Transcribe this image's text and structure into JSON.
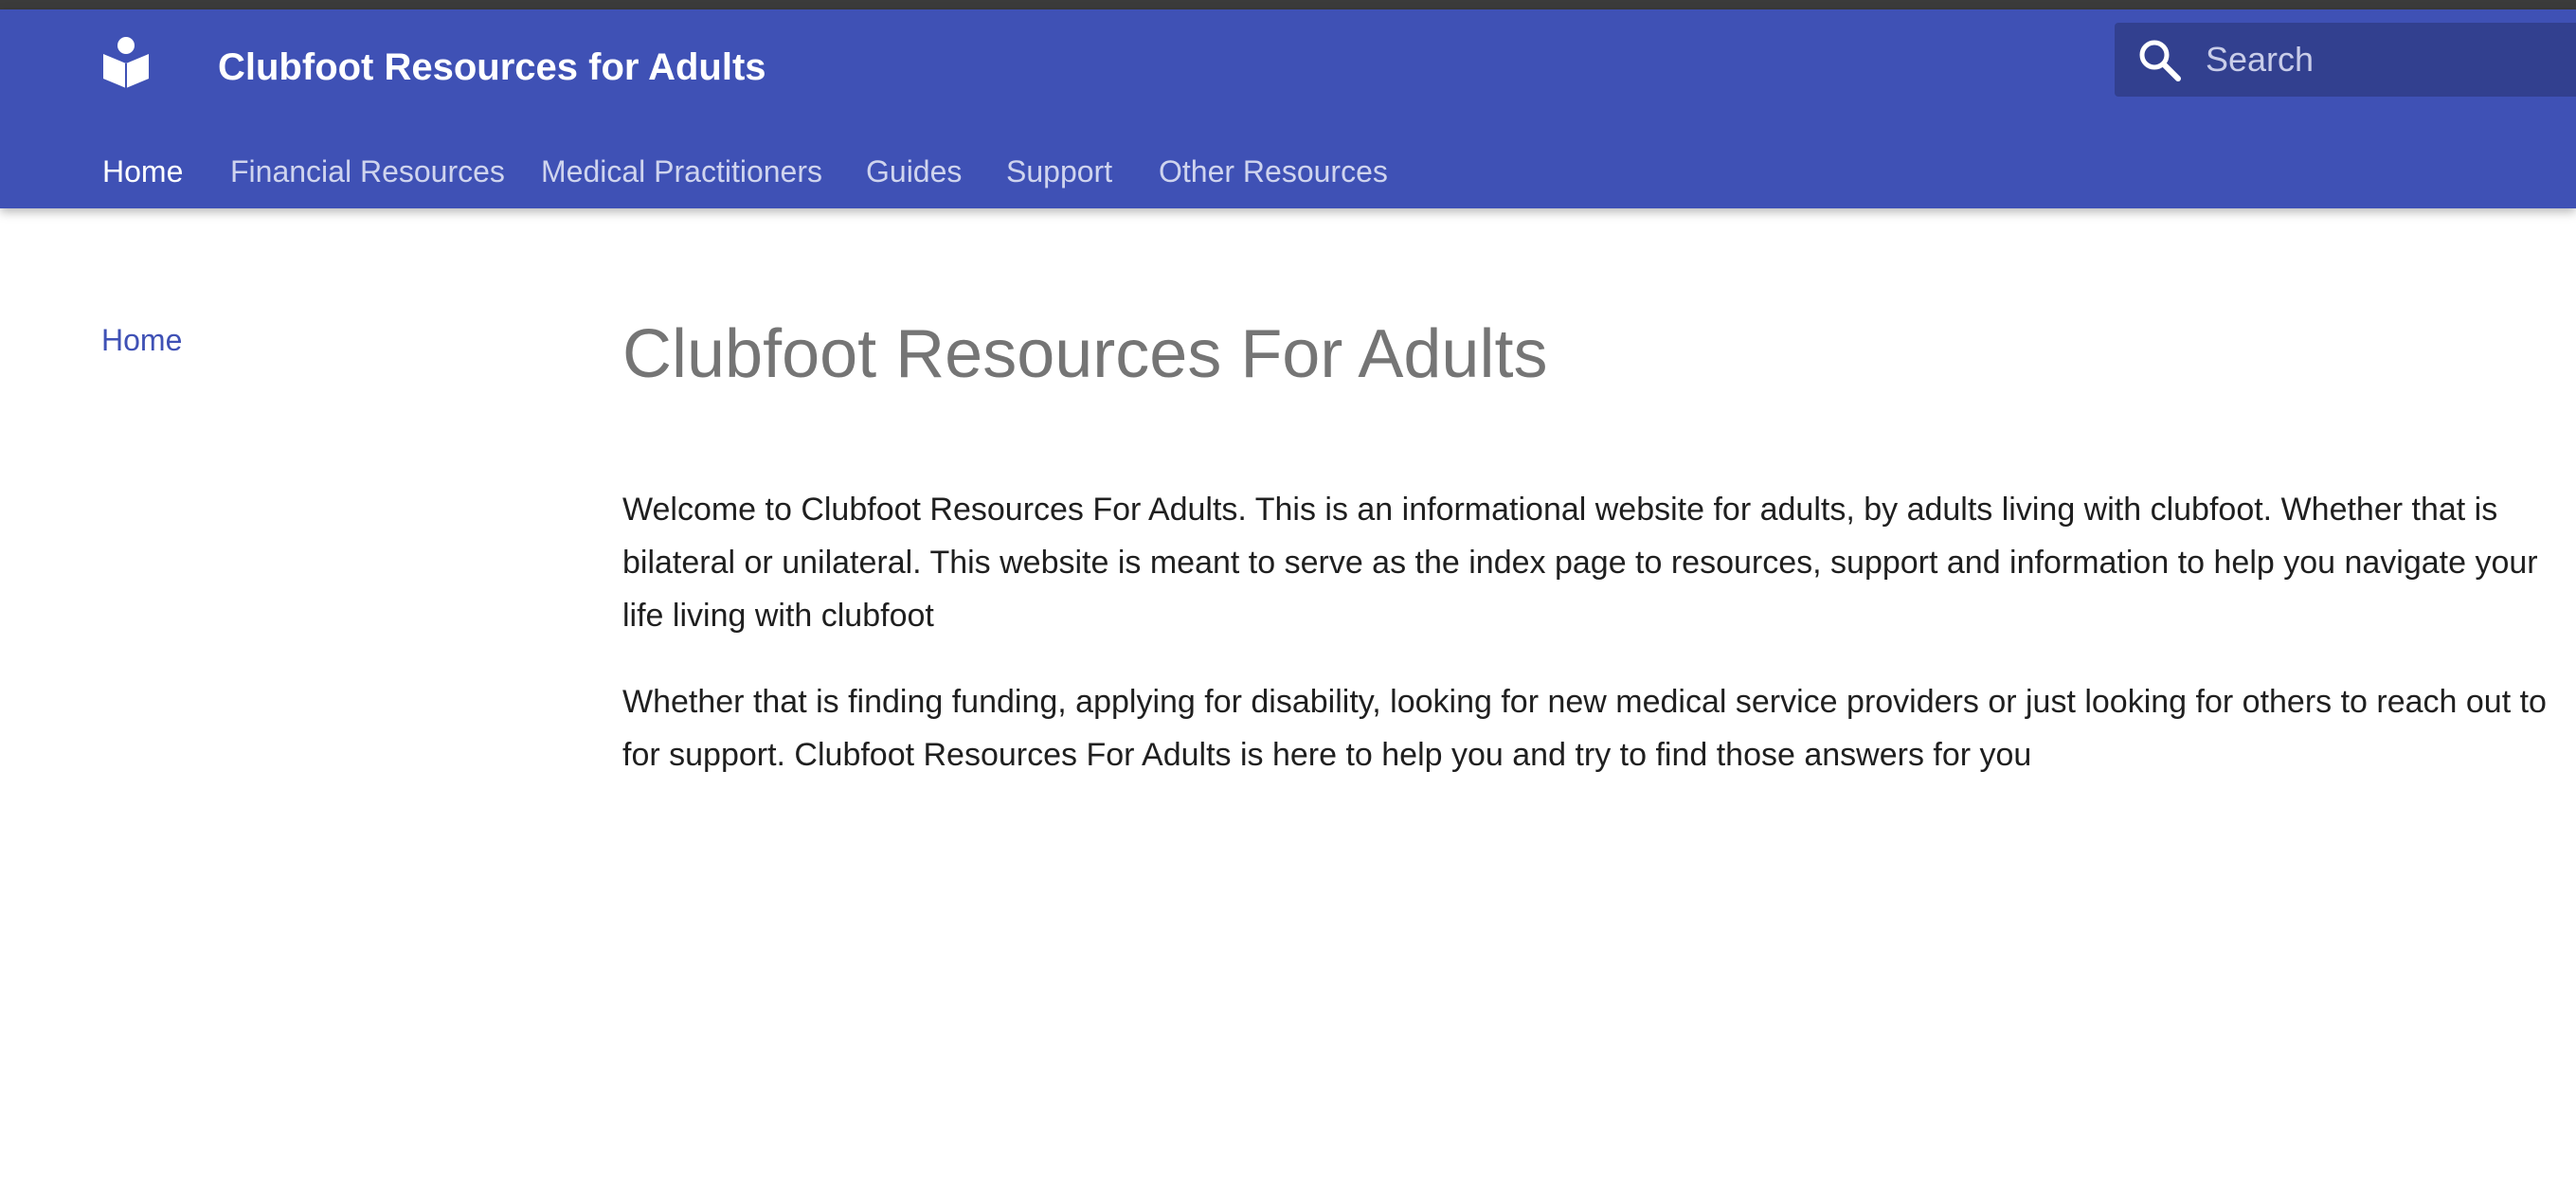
{
  "header": {
    "site_title": "Clubfoot Resources for Adults",
    "logo_icon": "book-reader-icon",
    "search": {
      "placeholder": "Search",
      "icon": "search-icon"
    },
    "nav": [
      {
        "label": "Home",
        "active": true
      },
      {
        "label": "Financial Resources",
        "active": false
      },
      {
        "label": "Medical Practitioners",
        "active": false
      },
      {
        "label": "Guides",
        "active": false
      },
      {
        "label": "Support",
        "active": false
      },
      {
        "label": "Other Resources",
        "active": false
      }
    ]
  },
  "sidebar": {
    "items": [
      {
        "label": "Home"
      }
    ]
  },
  "main": {
    "title": "Clubfoot Resources For Adults",
    "paragraphs": [
      "Welcome to Clubfoot Resources For Adults. This is an informational website for adults, by adults living with clubfoot. Whether that is bilateral or unilateral. This website is meant to serve as the index page to resources, support and information to help you navigate your life living with clubfoot",
      "Whether that is finding funding, applying for disability, looking for new medical service providers or just looking for others to reach out to for support. Clubfoot Resources For Adults is here to help you and try to find those answers for you"
    ]
  },
  "colors": {
    "header_bg": "#3f51b5",
    "search_bg": "#32408f",
    "top_strip": "#3b3b3b",
    "link": "#3f51b5",
    "title_text": "#757575",
    "body_text": "#1f1f1f"
  }
}
